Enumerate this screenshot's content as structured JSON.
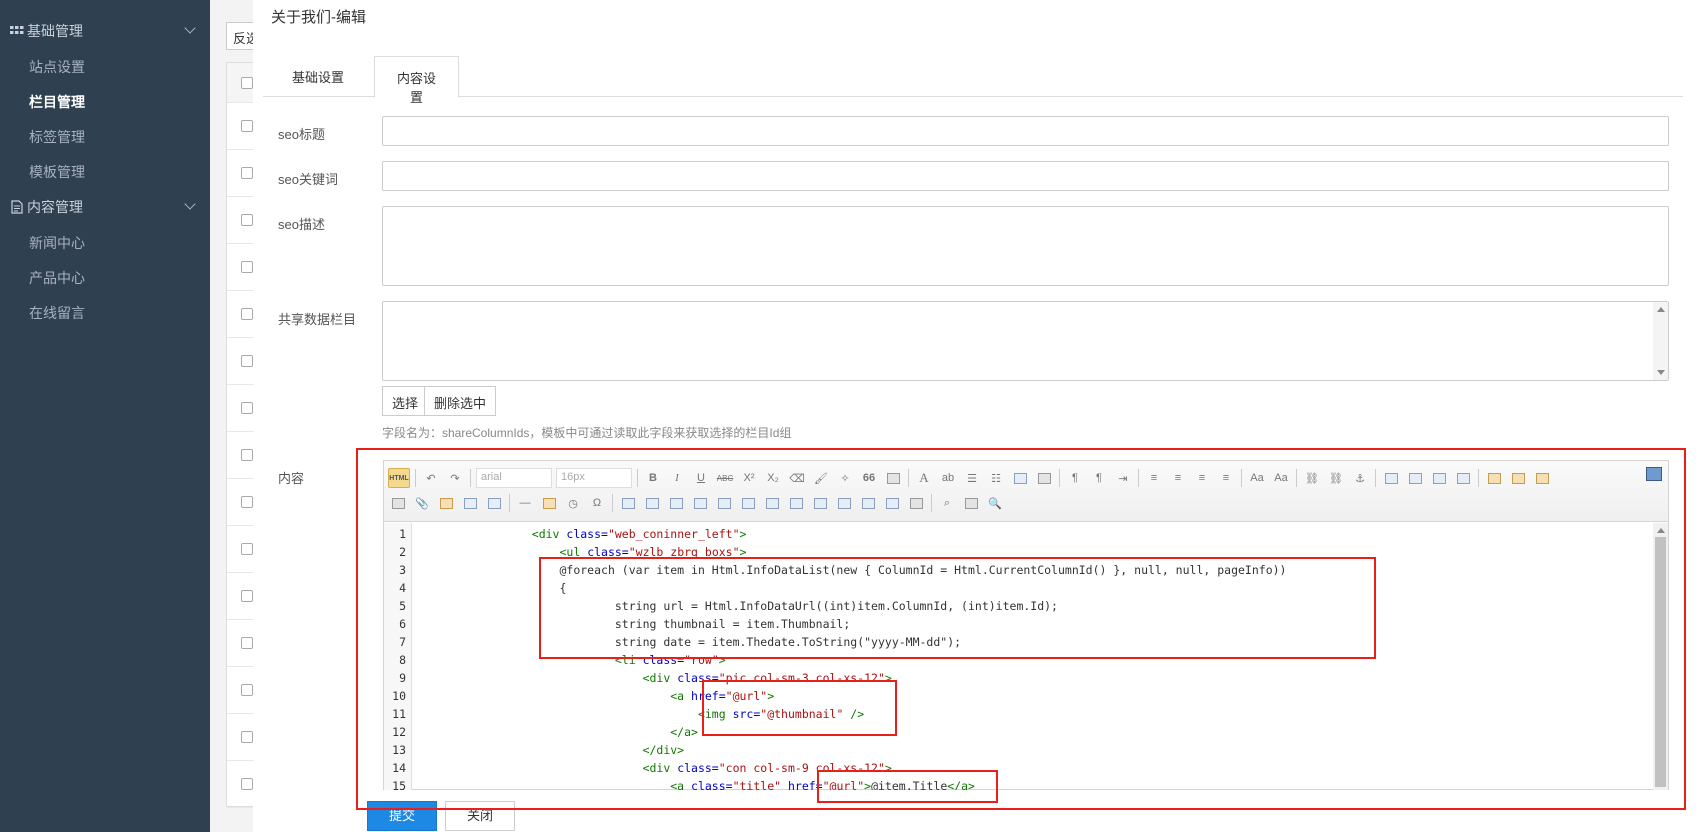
{
  "sidebar": {
    "groups": [
      {
        "label": "基础管理",
        "icon": "grid-icon",
        "items": [
          "站点设置",
          "栏目管理",
          "标签管理",
          "模板管理"
        ],
        "active": "栏目管理"
      },
      {
        "label": "内容管理",
        "icon": "document-icon",
        "items": [
          "新闻中心",
          "产品中心",
          "在线留言"
        ]
      }
    ]
  },
  "background": {
    "top_button": "反选"
  },
  "modal": {
    "title": "关于我们-编辑",
    "tabs": [
      "基础设置",
      "内容设置"
    ],
    "active_tab": "内容设置",
    "fields": {
      "seo_title": {
        "label": "seo标题",
        "value": ""
      },
      "seo_keywords": {
        "label": "seo关键词",
        "value": ""
      },
      "seo_description": {
        "label": "seo描述",
        "value": ""
      },
      "shared_columns": {
        "label": "共享数据栏目",
        "value": ""
      },
      "content": {
        "label": "内容"
      }
    },
    "buttons": {
      "select": "选择",
      "delete_selected": "删除选中",
      "submit": "提交",
      "close": "关闭"
    },
    "hint": "字段名为：shareColumnIds，模板中可通过读取此字段来获取选择的栏目Id组"
  },
  "editor": {
    "font_family": "arial",
    "font_size": "16px",
    "html_button": "HTML",
    "toolbar_glyphs": {
      "bold": "B",
      "italic": "I",
      "underline": "U",
      "strike": "ABC",
      "sup": "X²",
      "sub": "X₂",
      "quote": "66",
      "omega": "Ω",
      "font_color": "A"
    },
    "code_lines": [
      {
        "n": "1",
        "indent": "                ",
        "parts": [
          [
            "tag",
            "<div "
          ],
          [
            "attr",
            "class="
          ],
          [
            "str",
            "\"web_coninner_left\""
          ],
          [
            "tag",
            ">"
          ]
        ]
      },
      {
        "n": "2",
        "indent": "                    ",
        "parts": [
          [
            "tag",
            "<ul "
          ],
          [
            "attr",
            "class="
          ],
          [
            "str",
            "\"wzlb zbrg boxs\""
          ],
          [
            "tag",
            ">"
          ]
        ]
      },
      {
        "n": "3",
        "indent": "                    ",
        "parts": [
          [
            "txt",
            "@foreach (var item in Html.InfoDataList(new { ColumnId = Html.CurrentColumnId() }, null, null, pageInfo))"
          ]
        ]
      },
      {
        "n": "4",
        "indent": "                    ",
        "parts": [
          [
            "txt",
            "{"
          ]
        ]
      },
      {
        "n": "5",
        "indent": "                            ",
        "parts": [
          [
            "txt",
            "string url = Html.InfoDataUrl((int)item.ColumnId, (int)item.Id);"
          ]
        ]
      },
      {
        "n": "6",
        "indent": "                            ",
        "parts": [
          [
            "txt",
            "string thumbnail = item.Thumbnail;"
          ]
        ]
      },
      {
        "n": "7",
        "indent": "                            ",
        "parts": [
          [
            "txt",
            "string date = item.Thedate.ToString(\"yyyy-MM-dd\");"
          ]
        ]
      },
      {
        "n": "8",
        "indent": "                            ",
        "parts": [
          [
            "tag",
            "<li "
          ],
          [
            "attr",
            "class="
          ],
          [
            "str",
            "\"row\""
          ],
          [
            "tag",
            ">"
          ]
        ]
      },
      {
        "n": "9",
        "indent": "                                ",
        "parts": [
          [
            "tag",
            "<div "
          ],
          [
            "attr",
            "class="
          ],
          [
            "str",
            "\"pic col-sm-3 col-xs-12\""
          ],
          [
            "tag",
            ">"
          ]
        ]
      },
      {
        "n": "10",
        "indent": "                                    ",
        "parts": [
          [
            "tag",
            "<a "
          ],
          [
            "attr",
            "href="
          ],
          [
            "str",
            "\"@url\""
          ],
          [
            "tag",
            ">"
          ]
        ]
      },
      {
        "n": "11",
        "indent": "                                        ",
        "parts": [
          [
            "tag",
            "<img "
          ],
          [
            "attr",
            "src="
          ],
          [
            "str",
            "\"@thumbnail\""
          ],
          [
            "tag",
            " />"
          ]
        ]
      },
      {
        "n": "12",
        "indent": "                                    ",
        "parts": [
          [
            "tag",
            "</a>"
          ]
        ]
      },
      {
        "n": "13",
        "indent": "                                ",
        "parts": [
          [
            "tag",
            "</div>"
          ]
        ]
      },
      {
        "n": "14",
        "indent": "                                ",
        "parts": [
          [
            "tag",
            "<div "
          ],
          [
            "attr",
            "class="
          ],
          [
            "str",
            "\"con col-sm-9 col-xs-12\""
          ],
          [
            "tag",
            ">"
          ]
        ]
      },
      {
        "n": "15",
        "indent": "                                    ",
        "parts": [
          [
            "tag",
            "<a "
          ],
          [
            "attr",
            "class="
          ],
          [
            "str",
            "\"title\""
          ],
          [
            "attr",
            " href="
          ],
          [
            "str",
            "\"@url\""
          ],
          [
            "tag",
            ">"
          ],
          [
            "txt",
            "@item.Title"
          ],
          [
            "tag",
            "</a>"
          ]
        ]
      }
    ]
  },
  "colors": {
    "sidebar_bg": "#2f4050",
    "accent": "#1e88e5",
    "annotation": "#e8201a"
  }
}
